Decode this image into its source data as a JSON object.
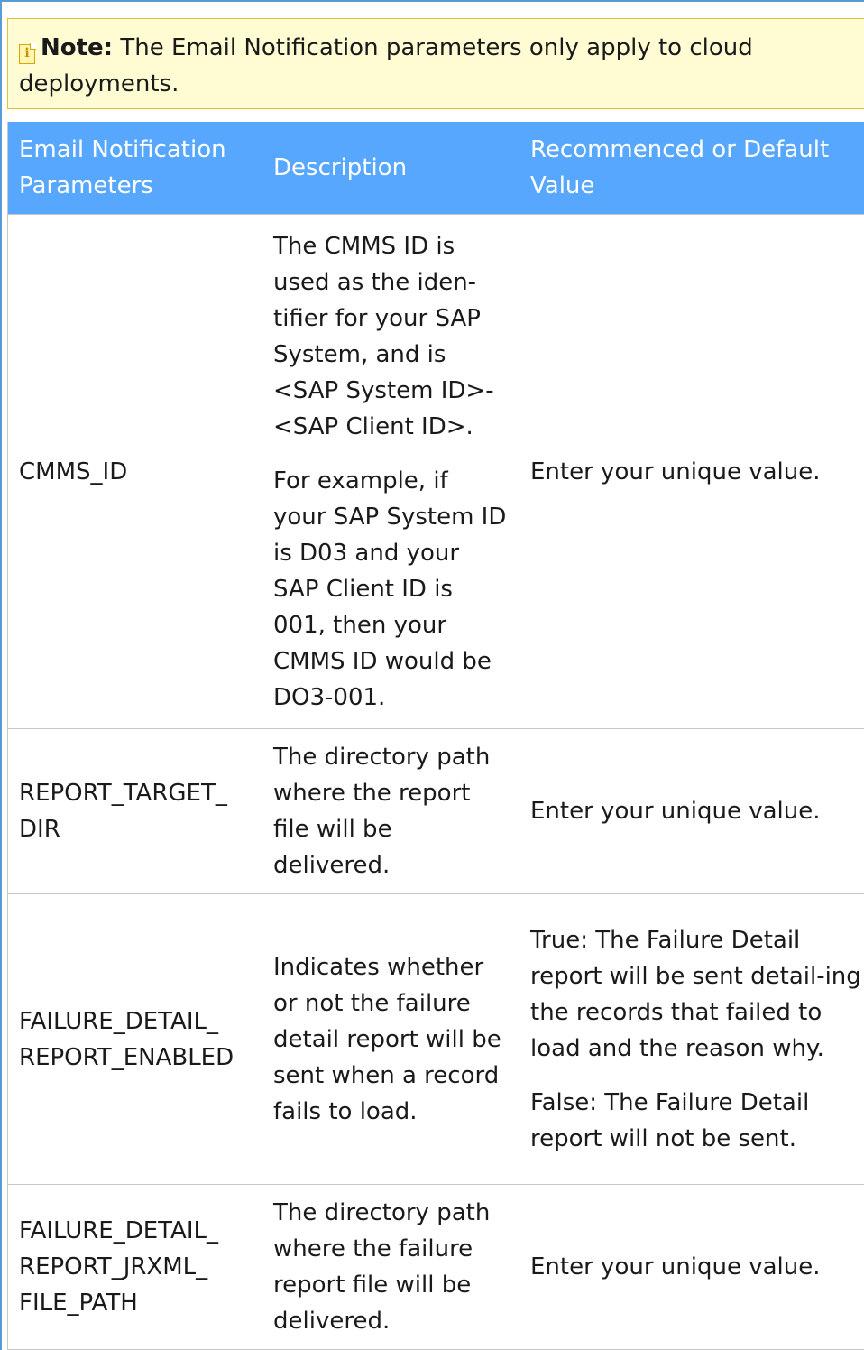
{
  "note": {
    "label": "Note:",
    "text": " The Email Notification parameters only apply to cloud deployments."
  },
  "table": {
    "headers": [
      "Email Notification Parameters",
      "Description",
      "Recommenced or Default Value"
    ],
    "rows": [
      {
        "param": "CMMS_ID",
        "desc": [
          "The CMMS ID is used as the iden-tifier for your SAP System, and is <SAP System ID>-<SAP Client ID>.",
          "For example, if your SAP System ID is D03 and your SAP Client ID is 001, then your CMMS ID would be DO3-001."
        ],
        "value": [
          "Enter your unique value."
        ]
      },
      {
        "param": "REPORT_TARGET_ DIR",
        "desc": [
          "The directory path where the report file will be delivered."
        ],
        "value": [
          "Enter your unique value."
        ]
      },
      {
        "param": "FAILURE_DETAIL_ REPORT_ENABLED",
        "desc": [
          "Indicates whether or not the failure detail report will be sent when a record fails to load."
        ],
        "value": [
          "True: The Failure Detail report will be sent detail-ing the records that failed to load and the reason why.",
          "False: The Failure Detail report will not be sent."
        ]
      },
      {
        "param": "FAILURE_DETAIL_ REPORT_JRXML_ FILE_PATH",
        "desc": [
          "The directory path where the failure report file will be delivered."
        ],
        "value": [
          "Enter your unique value."
        ]
      }
    ]
  }
}
